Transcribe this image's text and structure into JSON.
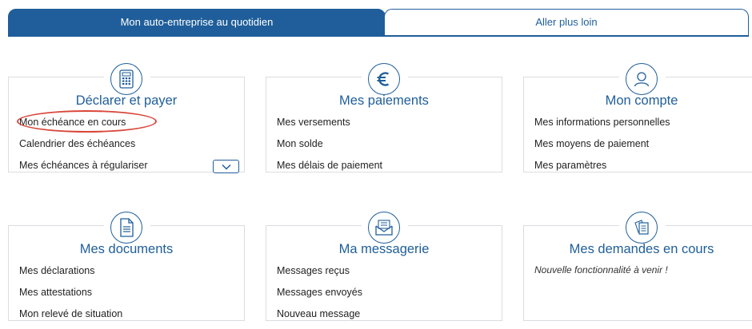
{
  "tabs": [
    {
      "label": "Mon auto-entreprise au quotidien"
    },
    {
      "label": "Aller plus loin"
    }
  ],
  "cards": [
    {
      "title": "Déclarer et payer",
      "icon": "calculator-icon",
      "items": [
        "Mon échéance en cours",
        "Calendrier des échéances",
        "Mes échéances à régulariser"
      ]
    },
    {
      "title": "Mes paiements",
      "icon": "euro-icon",
      "items": [
        "Mes versements",
        "Mon solde",
        "Mes délais de paiement"
      ]
    },
    {
      "title": "Mon compte",
      "icon": "user-icon",
      "items": [
        "Mes informations personnelles",
        "Mes moyens de paiement",
        "Mes paramètres"
      ]
    },
    {
      "title": "Mes documents",
      "icon": "document-icon",
      "items": [
        "Mes déclarations",
        "Mes attestations",
        "Mon relevé de situation"
      ]
    },
    {
      "title": "Ma messagerie",
      "icon": "envelope-icon",
      "items": [
        "Messages reçus",
        "Messages envoyés",
        "Nouveau message"
      ]
    },
    {
      "title": "Mes demandes en cours",
      "icon": "requests-icon",
      "note": "Nouvelle fonctionnalité à venir !"
    }
  ],
  "colors": {
    "accent": "#1f5e9a",
    "highlight": "#d9463a",
    "border": "#d9dde2"
  }
}
